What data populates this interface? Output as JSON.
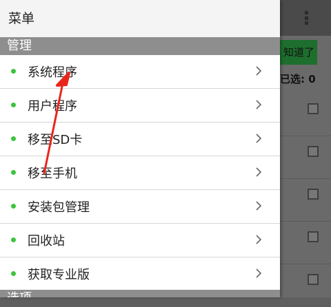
{
  "background": {
    "ok_button_label": "知道了",
    "selected_count": "已选: 0"
  },
  "drawer": {
    "title": "菜单",
    "sections": [
      {
        "title": "管理",
        "items": [
          {
            "label": "系统程序",
            "icon": "green-dot"
          },
          {
            "label": "用户程序",
            "icon": "green-dot"
          },
          {
            "label": "移至SD卡",
            "icon": "green-dot"
          },
          {
            "label": "移至手机",
            "icon": "green-dot"
          },
          {
            "label": "安装包管理",
            "icon": "green-dot"
          },
          {
            "label": "回收站",
            "icon": "green-dot"
          },
          {
            "label": "获取专业版",
            "icon": "green-dot"
          }
        ]
      },
      {
        "title": "选项"
      }
    ]
  },
  "colors": {
    "accent_green": "#3cc43c",
    "section_header": "#8e8e8e",
    "annotation_arrow": "#e8261c",
    "ok_button": "#1e6f2e"
  }
}
